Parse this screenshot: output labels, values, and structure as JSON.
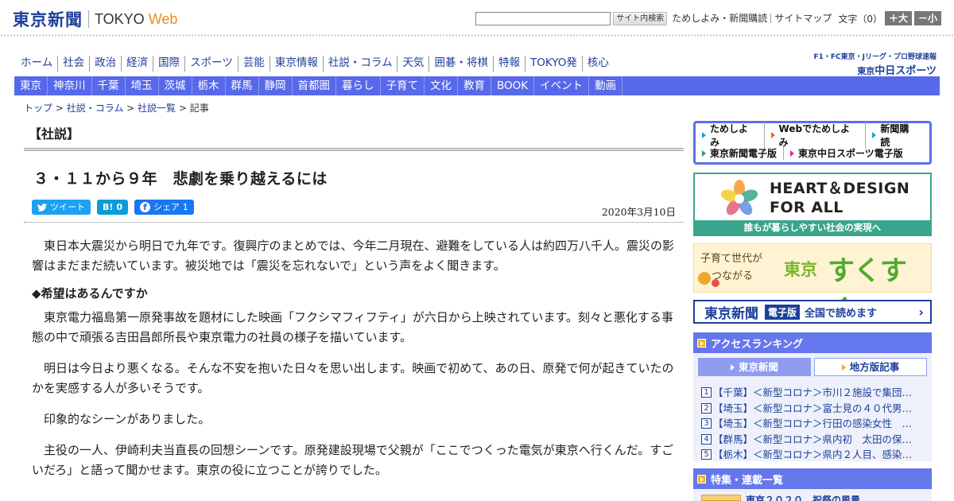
{
  "header": {
    "logo_jp": "東京新聞",
    "logo_tokyo": "TOKYO",
    "logo_web": "Web",
    "search_button": "サイト内検索",
    "links": [
      "ためしよみ・新聞購読",
      "サイトマップ"
    ],
    "font_size_label": "文字（0）",
    "font_plus": "＋大",
    "font_minus": "－小"
  },
  "nav_main": [
    "ホーム",
    "社会",
    "政治",
    "経済",
    "国際",
    "スポーツ",
    "芸能",
    "東京情報",
    "社説・コラム",
    "天気",
    "囲碁・将棋",
    "特報",
    "TOKYO発",
    "核心"
  ],
  "chunichi": {
    "top": "F1・FC東京・Jリーグ・プロ野球速報",
    "small": "東京",
    "main": "中日スポーツ"
  },
  "nav_region": [
    "東京",
    "神奈川",
    "千葉",
    "埼玉",
    "茨城",
    "栃木",
    "群馬",
    "静岡",
    "首都圏",
    "暮らし",
    "子育て",
    "文化",
    "教育",
    "BOOK",
    "イベント",
    "動画"
  ],
  "breadcrumb": {
    "items": [
      "トップ",
      "社説・コラム",
      "社説一覧"
    ],
    "current": "記事",
    "sep": " > "
  },
  "article": {
    "section": "【社説】",
    "title": "３・１１から９年　悲劇を乗り越えるには",
    "date": "2020年3月10日",
    "share": {
      "tweet": "ツイート",
      "hatena_icon": "B!",
      "hatena_count": "0",
      "fb_icon": "f",
      "fb_label": "シェア",
      "fb_count": "1"
    },
    "paragraphs": {
      "p1": "東日本大震災から明日で九年です。復興庁のまとめでは、今年二月現在、避難をしている人は約四万八千人。震災の影響はまだまだ続いています。被災地では「震災を忘れないで」という声をよく聞きます。",
      "h1": "◆希望はあるんですか",
      "p2": "東京電力福島第一原発事故を題材にした映画「フクシマフィフティ」が六日から上映されています。刻々と悪化する事態の中で頑張る吉田昌郎所長や東京電力の社員の様子を描いています。",
      "p3": "明日は今日より悪くなる。そんな不安を抱いた日々を思い出します。映画で初めて、あの日、原発で何が起きていたのかを実感する人が多いそうです。",
      "p4": "印象的なシーンがありました。",
      "p5": "主役の一人、伊崎利夫当直長の回想シーンです。原発建設現場で父親が「ここでつくった電気が東京へ行くんだ。すごいだろ」と語って聞かせます。東京の役に立つことが誇りでした。"
    }
  },
  "sidebar": {
    "promo": {
      "row1": [
        "ためしよみ",
        "Webでためしよみ",
        "新聞購読"
      ],
      "row2": [
        "東京新聞電子版",
        "東京中日スポーツ電子版"
      ]
    },
    "heart": {
      "line1": "HEART＆DESIGN",
      "line2": "FOR ALL",
      "sub": "誰もが暮らしやすい社会の実現へ"
    },
    "sukusuku": {
      "line1": "子育て世代が",
      "line2": "つながる",
      "tokyo": "東京",
      "big": "すくすく"
    },
    "ebook": {
      "logo": "東京新聞",
      "tag": "電子版",
      "text": "全国で読めます",
      "arrow": "›"
    },
    "ranking": {
      "title": "アクセスランキング",
      "tabs": [
        "東京新聞",
        "地方版記事"
      ],
      "items": [
        {
          "num": "1",
          "text": "【千葉】＜新型コロナ＞市川２施設で集団…"
        },
        {
          "num": "2",
          "text": "【埼玉】＜新型コロナ＞富士見の４０代男…"
        },
        {
          "num": "3",
          "text": "【埼玉】＜新型コロナ＞行田の感染女性　…"
        },
        {
          "num": "4",
          "text": "【群馬】＜新型コロナ＞県内初　太田の保…"
        },
        {
          "num": "5",
          "text": "【栃木】＜新型コロナ＞県内２人目、感染…"
        }
      ]
    },
    "feature": {
      "title": "特集・連載一覧",
      "item": "東京２０２０　祝祭の風景"
    }
  },
  "colors": {
    "brand_blue": "#1c3f9a",
    "nav_blue": "#5769ea",
    "orange": "#e8901c",
    "green": "#3aa58d"
  }
}
